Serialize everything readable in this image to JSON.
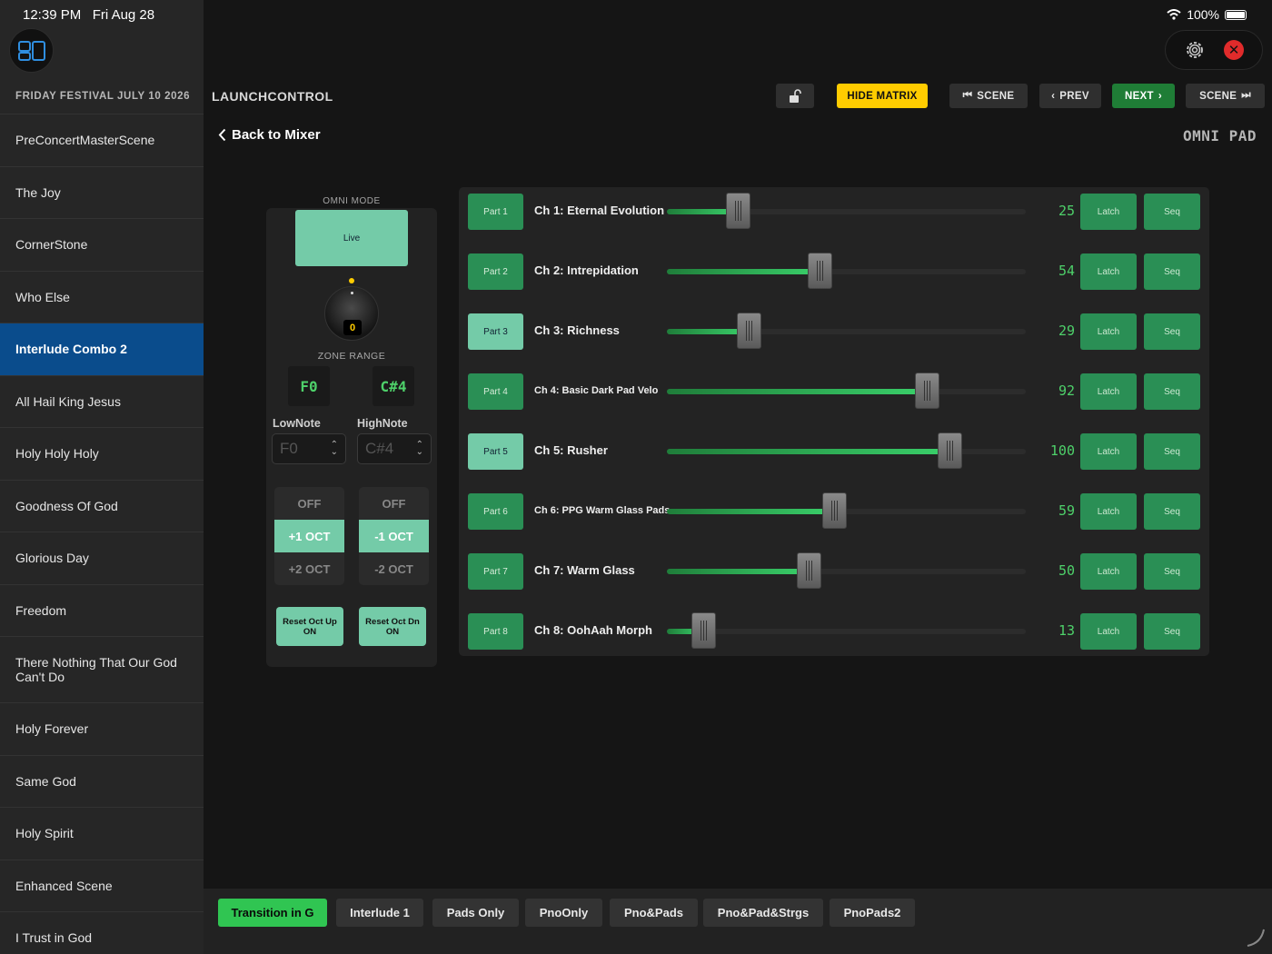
{
  "status": {
    "time": "12:39 PM",
    "date": "Fri Aug 28",
    "battery": "100%"
  },
  "sidebar": {
    "event_title": "FRIDAY FESTIVAL JULY 10 2026",
    "songs": [
      {
        "label": "PreConcertMasterScene"
      },
      {
        "label": "The Joy"
      },
      {
        "label": "CornerStone"
      },
      {
        "label": "Who Else"
      },
      {
        "label": "Interlude Combo 2",
        "active": true
      },
      {
        "label": "All Hail King Jesus"
      },
      {
        "label": "Holy Holy Holy"
      },
      {
        "label": "Goodness Of God"
      },
      {
        "label": "Glorious Day"
      },
      {
        "label": "Freedom"
      },
      {
        "label": "There Nothing That Our God Can't Do"
      },
      {
        "label": "Holy Forever"
      },
      {
        "label": "Same God"
      },
      {
        "label": "Holy Spirit"
      },
      {
        "label": "Enhanced Scene"
      },
      {
        "label": "I Trust in God"
      }
    ]
  },
  "toolbar": {
    "app_title": "LAUNCHCONTROL",
    "hide_matrix": "HIDE MATRIX",
    "scene_prev": "SCENE",
    "prev": "PREV",
    "next": "NEXT",
    "scene_next": "SCENE",
    "accent_yellow": "#ffcc00",
    "accent_green": "#1f7d36"
  },
  "nav": {
    "back": "Back to Mixer",
    "section": "OMNI PAD"
  },
  "omni": {
    "mode_label": "OMNI MODE",
    "mode_button": "Live",
    "knob_value": "0",
    "zone_range_label": "ZONE RANGE",
    "low_note": "F0",
    "high_note": "C#4",
    "low_label": "LowNote",
    "high_label": "HighNote",
    "low_select": "F0",
    "high_select": "C#4",
    "up_options": [
      {
        "label": "OFF"
      },
      {
        "label": "+1 OCT",
        "selected": true
      },
      {
        "label": "+2 OCT"
      }
    ],
    "down_options": [
      {
        "label": "OFF"
      },
      {
        "label": "-1 OCT",
        "selected": true
      },
      {
        "label": "-2 OCT"
      }
    ],
    "reset_up": "Reset Oct Up ON",
    "reset_down": "Reset Oct Dn ON"
  },
  "channels": [
    {
      "part": "Part 1",
      "name": "Ch 1: Eternal Evolution",
      "value": 25,
      "highlight": false
    },
    {
      "part": "Part 2",
      "name": "Ch 2: Intrepidation",
      "value": 54,
      "highlight": false
    },
    {
      "part": "Part 3",
      "name": "Ch 3: Richness",
      "value": 29,
      "highlight": true
    },
    {
      "part": "Part 4",
      "name": "Ch 4: Basic Dark Pad Velo",
      "value": 92,
      "highlight": false
    },
    {
      "part": "Part 5",
      "name": "Ch 5: Rusher",
      "value": 100,
      "highlight": true
    },
    {
      "part": "Part 6",
      "name": "Ch 6: PPG Warm Glass Pads",
      "value": 59,
      "highlight": false
    },
    {
      "part": "Part 7",
      "name": "Ch 7: Warm Glass",
      "value": 50,
      "highlight": false
    },
    {
      "part": "Part 8",
      "name": "Ch 8: OohAah Morph",
      "value": 13,
      "highlight": false
    }
  ],
  "channel_buttons": {
    "latch": "Latch",
    "seq": "Seq"
  },
  "fader_range": [
    0,
    127
  ],
  "scenes": [
    {
      "label": "Transition in G",
      "active": true
    },
    {
      "label": "Interlude 1"
    },
    {
      "label": "Pads Only"
    },
    {
      "label": "PnoOnly"
    },
    {
      "label": "Pno&Pads"
    },
    {
      "label": "Pno&Pad&Strgs"
    },
    {
      "label": "PnoPads2"
    }
  ]
}
